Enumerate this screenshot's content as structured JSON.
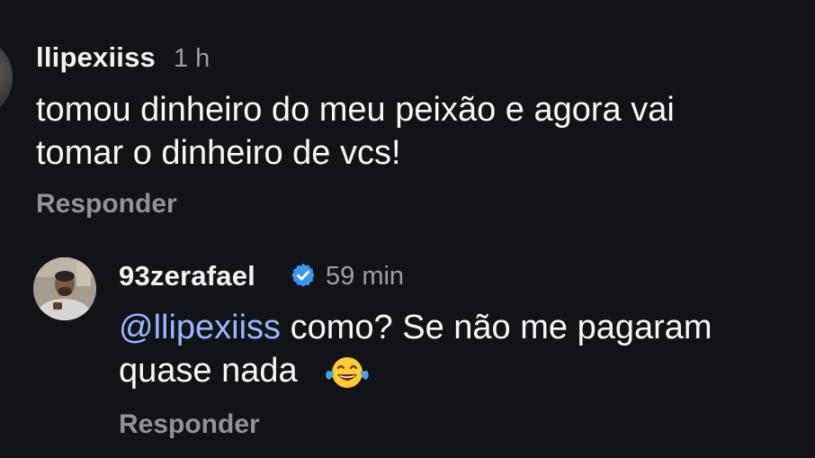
{
  "comments": [
    {
      "username": "llipexiiss",
      "time": "1 h",
      "text_line1": "tomou dinheiro do meu peixão e agora vai",
      "text_line2": "tomar o dinheiro de vcs!",
      "reply_label": "Responder"
    },
    {
      "username": "93zerafael",
      "verified_icon": "verified-badge-icon",
      "time": "59 min",
      "mention": "@llipexiiss",
      "text_line1_rest": " como? Se não me pagaram",
      "text_line2": "quase nada",
      "emoji_icon": "face-with-tears-of-joy-icon",
      "reply_label": "Responder"
    }
  ],
  "colors": {
    "background": "#111317",
    "text": "#f7f7f7",
    "secondary": "#9b9ea3",
    "mention": "#9ab6ff",
    "verified": "#3897f0"
  }
}
